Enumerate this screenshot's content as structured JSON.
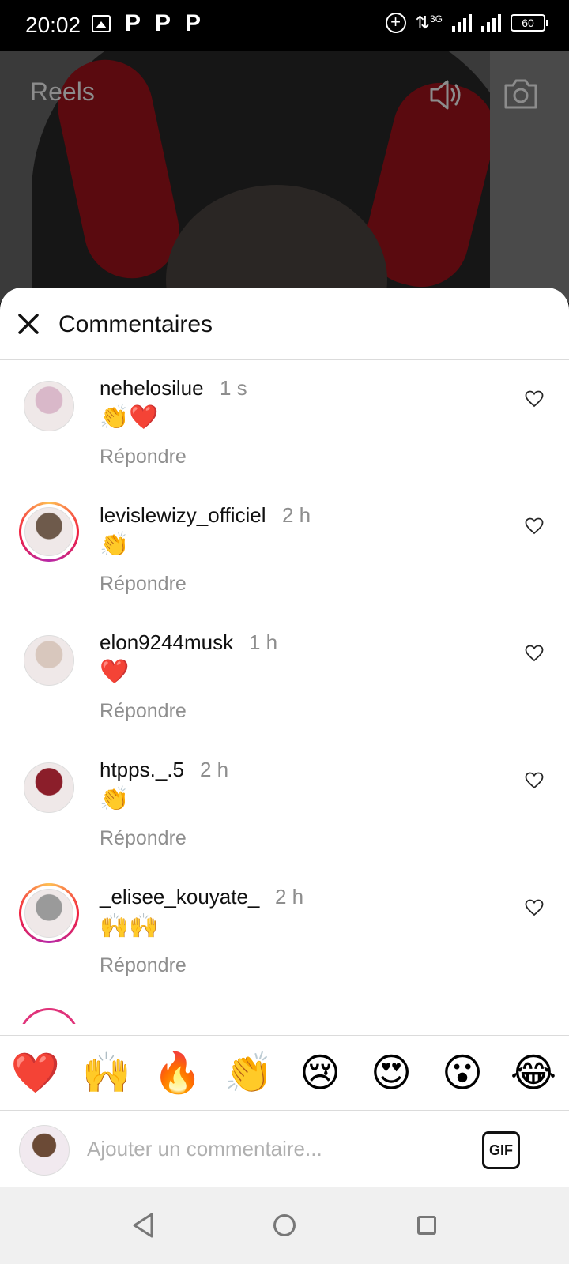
{
  "status_bar": {
    "time": "20:02",
    "left_icons": [
      "gallery-icon",
      "p-icon",
      "p-icon",
      "p-icon"
    ],
    "network": "3G",
    "battery": "60"
  },
  "header": {
    "title": "Reels",
    "icons": [
      "speaker-icon",
      "camera-icon"
    ]
  },
  "sheet": {
    "title": "Commentaires",
    "reply_label": "Répondre",
    "comments": [
      {
        "user": "nehelosilue",
        "time": "1 s",
        "text": "👏❤️",
        "avatar_color": "#d9b8c9",
        "story": false
      },
      {
        "user": "levislewizy_officiel",
        "time": "2 h",
        "text": "👏",
        "avatar_color": "#6e5a4b",
        "story": true
      },
      {
        "user": "elon9244musk",
        "time": "1 h",
        "text": "❤️",
        "avatar_color": "#d8c7bd",
        "story": false
      },
      {
        "user": "htpps._.5",
        "time": "2 h",
        "text": "👏",
        "avatar_color": "#8b1e2a",
        "story": false
      },
      {
        "user": "_elisee_kouyate_",
        "time": "2 h",
        "text": "🙌🙌",
        "avatar_color": "#9a9a9a",
        "story": true
      }
    ]
  },
  "emoji_bar": [
    "❤️",
    "🙌",
    "🔥",
    "👏",
    "😢",
    "😍",
    "😮",
    "😂"
  ],
  "input": {
    "placeholder": "Ajouter un commentaire...",
    "gif_label": "GIF"
  },
  "colors": {
    "accent_like": "#262626",
    "secondary_text": "#8e8e8e",
    "story_ring": "#f2203e"
  }
}
